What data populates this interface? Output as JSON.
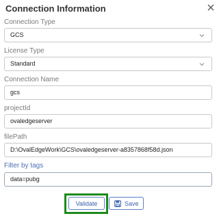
{
  "dialog": {
    "title": "Connection Information",
    "close_icon": "close-icon"
  },
  "fields": {
    "connection_type": {
      "label": "Connection Type",
      "value": "GCS",
      "icon": "chevron-down-icon"
    },
    "license_type": {
      "label": "License Type",
      "value": "Standard",
      "icon": "chevron-down-icon"
    },
    "connection_name": {
      "label": "Connection Name",
      "value": "gcs"
    },
    "project_id": {
      "label": "projectId",
      "value": "ovaledgeserver"
    },
    "file_path": {
      "label": "filePath",
      "value": "D:\\OvalEdgeWork\\GCS\\ovaledgeserver-a8357868f58d.json"
    },
    "filter_by_tags": {
      "label": "Filter by tags",
      "value_prefix": "data=",
      "value_suffix": "pubg"
    }
  },
  "actions": {
    "validate_label": "Validate",
    "save_label": "Save",
    "save_icon": "save-icon"
  },
  "colors": {
    "accent": "#3b62ad",
    "highlight_outline": "#1c8a1c",
    "active_label": "#4a6fb5"
  }
}
